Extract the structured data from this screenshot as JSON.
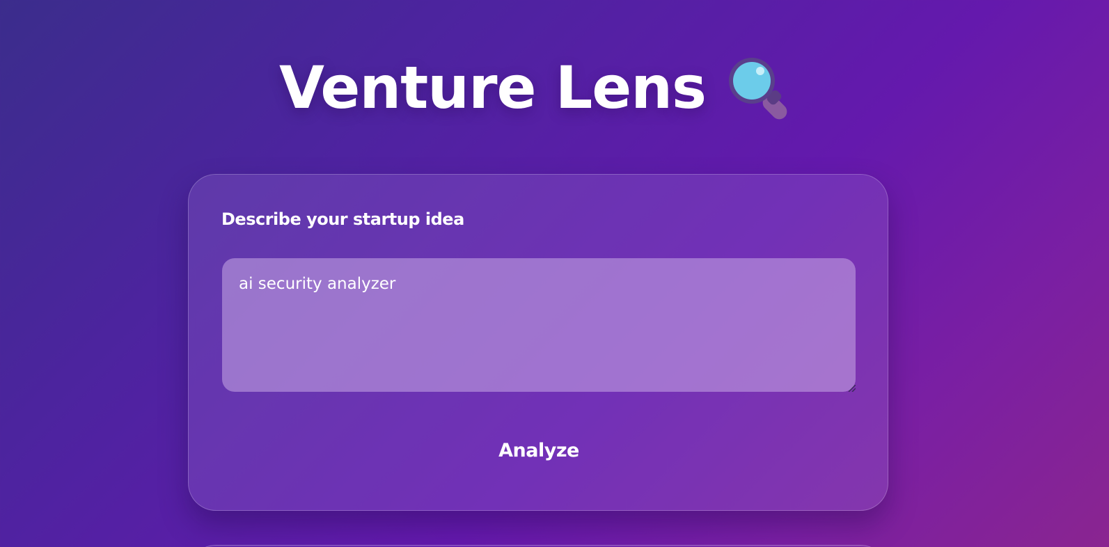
{
  "header": {
    "title": "Venture Lens",
    "title_icon": "magnifying-glass-icon"
  },
  "form": {
    "label": "Describe your startup idea",
    "idea_value": "ai security analyzer",
    "analyze_label": "Analyze"
  },
  "colors": {
    "background_start": "#3b2d8c",
    "background_end": "#8a2590",
    "text": "#ffffff",
    "lens_glass": "#6cccea",
    "lens_frame": "#6a4a9a"
  }
}
